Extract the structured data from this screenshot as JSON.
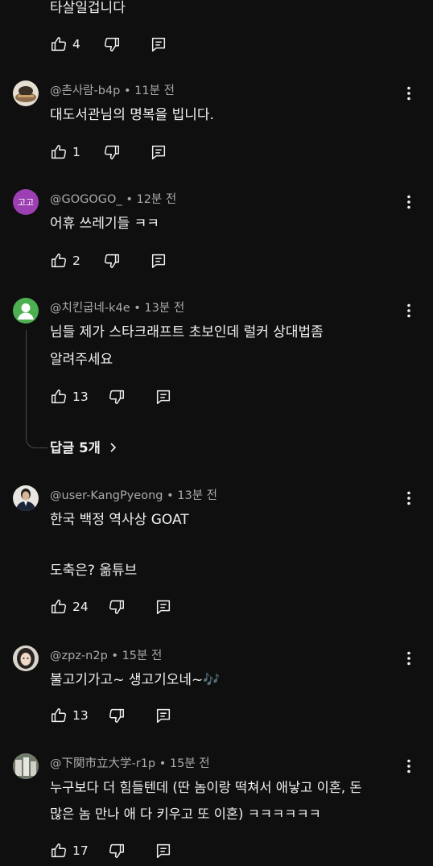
{
  "comments": [
    {
      "text_lines": [
        "타살일겁니다"
      ],
      "likes": "4"
    },
    {
      "author": "@촌사람-b4p",
      "time": "11분 전",
      "text_lines": [
        "대도서관님의 명복을 빕니다."
      ],
      "likes": "1",
      "avatar_icon": "photo-avatar"
    },
    {
      "author": "@GOGOGO_",
      "time": "12분 전",
      "text_lines": [
        "어휴 쓰레기들 ㅋㅋ"
      ],
      "likes": "2",
      "avatar_text": "고고",
      "avatar_color": "#9c3fb3"
    },
    {
      "author": "@치킨굽네-k4e",
      "time": "13분 전",
      "text_lines": [
        "님들 제가 스타크래프트 초보인데 럴커 상대법좀",
        "알려주세요"
      ],
      "likes": "13",
      "avatar_icon": "default-person-avatar",
      "avatar_color": "#4caf50",
      "replies_label": "답글 5개"
    },
    {
      "author": "@user-KangPyeong",
      "time": "13분 전",
      "text_lines": [
        "한국 백정 역사상 GOAT",
        "",
        "도축은? 옮튜브"
      ],
      "likes": "24",
      "avatar_icon": "photo-avatar"
    },
    {
      "author": "@zpz-n2p",
      "time": "15분 전",
      "text_lines": [
        "불고기가고~ 생고기오네~🎶"
      ],
      "likes": "13",
      "avatar_icon": "photo-avatar"
    },
    {
      "author": "@下関市立大学-r1p",
      "time": "15분 전",
      "text_lines": [
        "누구보다 더 힘들텐데 (딴 놈이랑 떡쳐서 애낳고 이혼, 돈",
        "많은 놈 만나 애 다 키우고 또 이혼) ㅋㅋㅋㅋㅋㅋ"
      ],
      "likes": "17",
      "avatar_icon": "photo-avatar"
    }
  ],
  "meta_separator": "•",
  "icons": {
    "like": "thumbs-up-icon",
    "dislike": "thumbs-down-icon",
    "reply": "reply-icon",
    "more": "more-vert-icon",
    "replies_chevron": "chevron-right-icon"
  },
  "colors": {
    "background": "#0f0f0f",
    "text": "#f1f1f1",
    "meta": "#aaaaaa"
  }
}
